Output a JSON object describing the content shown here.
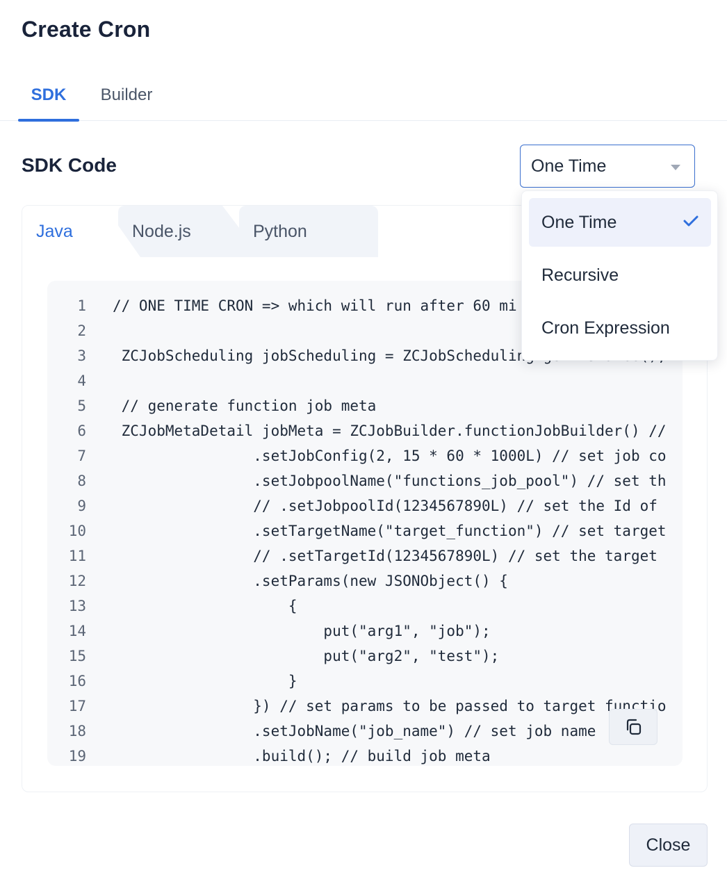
{
  "dialog": {
    "title": "Create Cron"
  },
  "tabs": [
    {
      "label": "SDK",
      "active": true
    },
    {
      "label": "Builder",
      "active": false
    }
  ],
  "sdk_section": {
    "label": "SDK Code"
  },
  "schedule_select": {
    "value": "One Time",
    "options": [
      {
        "label": "One Time",
        "selected": true
      },
      {
        "label": "Recursive",
        "selected": false
      },
      {
        "label": "Cron Expression",
        "selected": false
      }
    ]
  },
  "language_tabs": [
    {
      "label": "Java",
      "active": true
    },
    {
      "label": "Node.js",
      "active": false
    },
    {
      "label": "Python",
      "active": false
    }
  ],
  "code_lines": [
    {
      "n": "1",
      "text": "// ONE TIME CRON => which will run after 60 mi"
    },
    {
      "n": "2",
      "text": ""
    },
    {
      "n": "3",
      "text": " ZCJobScheduling jobScheduling = ZCJobScheduling.getInstance();"
    },
    {
      "n": "4",
      "text": ""
    },
    {
      "n": "5",
      "text": " // generate function job meta"
    },
    {
      "n": "6",
      "text": " ZCJobMetaDetail jobMeta = ZCJobBuilder.functionJobBuilder() //"
    },
    {
      "n": "7",
      "text": "                .setJobConfig(2, 15 * 60 * 1000L) // set job co"
    },
    {
      "n": "8",
      "text": "                .setJobpoolName(\"functions_job_pool\") // set th"
    },
    {
      "n": "9",
      "text": "                // .setJobpoolId(1234567890L) // set the Id of"
    },
    {
      "n": "10",
      "text": "                .setTargetName(\"target_function\") // set target"
    },
    {
      "n": "11",
      "text": "                // .setTargetId(1234567890L) // set the target"
    },
    {
      "n": "12",
      "text": "                .setParams(new JSONObject() {"
    },
    {
      "n": "13",
      "text": "                    {"
    },
    {
      "n": "14",
      "text": "                        put(\"arg1\", \"job\");"
    },
    {
      "n": "15",
      "text": "                        put(\"arg2\", \"test\");"
    },
    {
      "n": "16",
      "text": "                    }"
    },
    {
      "n": "17",
      "text": "                }) // set params to be passed to target functio"
    },
    {
      "n": "18",
      "text": "                .setJobName(\"job_name\") // set job name"
    },
    {
      "n": "19",
      "text": "                .build(); // build job meta"
    }
  ],
  "footer": {
    "close_label": "Close"
  },
  "colors": {
    "accent": "#2f6fdd",
    "title": "#19233a",
    "code_bg": "#f7f8fa"
  },
  "icons": {
    "copy": "copy-icon",
    "caret": "chevron-down-icon",
    "check": "check-icon"
  }
}
